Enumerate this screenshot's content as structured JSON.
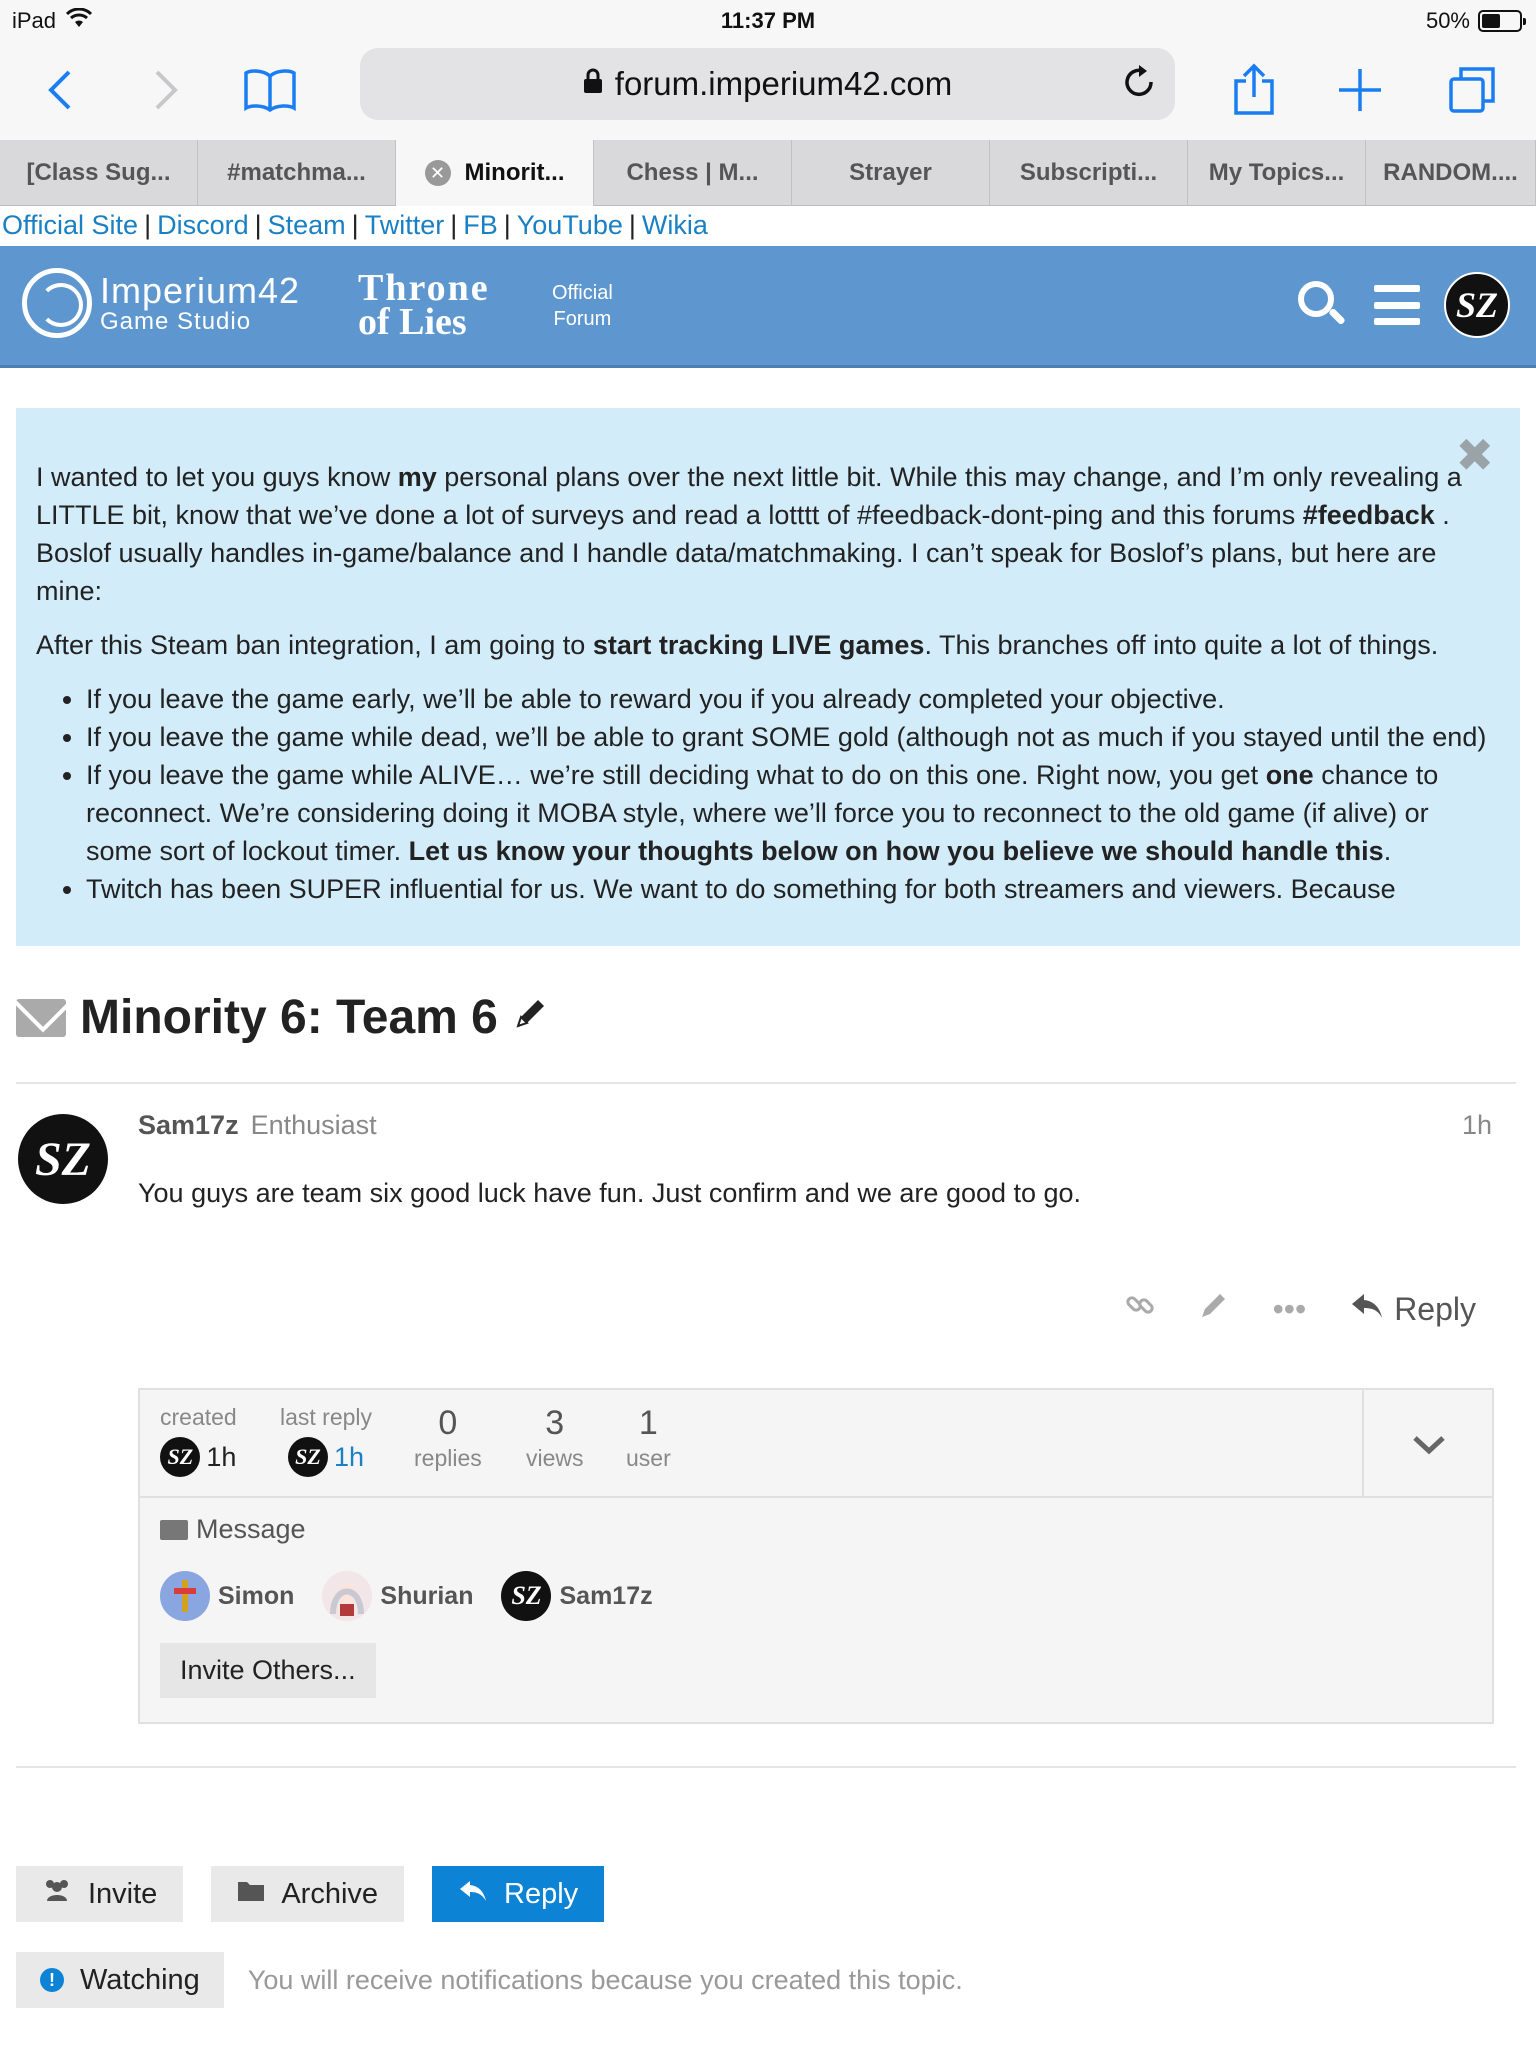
{
  "status": {
    "device": "iPad",
    "time": "11:37 PM",
    "battery": "50%"
  },
  "browser": {
    "url": "forum.imperium42.com",
    "tabs": [
      {
        "label": "[Class Sug..."
      },
      {
        "label": "#matchma..."
      },
      {
        "label": "Minorit..."
      },
      {
        "label": "Chess | M..."
      },
      {
        "label": "Strayer"
      },
      {
        "label": "Subscripti..."
      },
      {
        "label": "My Topics..."
      },
      {
        "label": "RANDOM...."
      }
    ]
  },
  "links": [
    "Official Site",
    "Discord",
    "Steam",
    "Twitter",
    "FB",
    "YouTube",
    "Wikia"
  ],
  "header": {
    "studio_line1": "Imperium42",
    "studio_line2": "Game Studio",
    "game_line1": "Throne",
    "game_line2": "of Lies",
    "official_line1": "Official",
    "official_line2": "Forum",
    "avatar_text": "SZ"
  },
  "announcement": {
    "p1_a": "I wanted to let you guys know ",
    "p1_b": "my",
    "p1_c": " personal plans over the next little bit. While this may change, and I’m only revealing a LITTLE bit, know that we’ve done a lot of surveys and read a lotttt of #feedback-dont-ping and this forums ",
    "p1_d": "#feedback",
    "p1_e": " . Boslof usually handles in-game/balance and I handle data/matchmaking. I can’t speak for Boslof’s plans, but here are mine:",
    "p2_a": "After this Steam ban integration, I am going to ",
    "p2_b": "start tracking LIVE games",
    "p2_c": ". This branches off into quite a lot of things.",
    "li1": "If you leave the game early, we’ll be able to reward you if you already completed your objective.",
    "li2": "If you leave the game while dead, we’ll be able to grant SOME gold (although not as much if you stayed until the end)",
    "li3_a": "If you leave the game while ALIVE… we’re still deciding what to do on this one. Right now, you get ",
    "li3_b": "one",
    "li3_c": " chance to reconnect. We’re considering doing it MOBA style, where we’ll force you to reconnect to the old game (if alive) or some sort of lockout timer. ",
    "li3_d": "Let us know your thoughts below on how you believe we should handle this",
    "li3_e": ".",
    "li4": "Twitch has been SUPER influential for us. We want to do something for both streamers and viewers. Because"
  },
  "topic": {
    "title": "Minority 6: Team 6"
  },
  "post": {
    "username": "Sam17z",
    "user_title": "Enthusiast",
    "age": "1h",
    "body": "You guys are team six good luck have fun. Just confirm and we are good to go.",
    "reply_label": "Reply"
  },
  "topic_map": {
    "created_label": "created",
    "created_value": "1h",
    "last_reply_label": "last reply",
    "last_reply_value": "1h",
    "replies_num": "0",
    "replies_label": "replies",
    "views_num": "3",
    "views_label": "views",
    "users_num": "1",
    "users_label": "user",
    "message_label": "Message",
    "participants": [
      {
        "name": "Simon"
      },
      {
        "name": "Shurian"
      },
      {
        "name": "Sam17z"
      }
    ],
    "invite_others": "Invite Others..."
  },
  "footer": {
    "invite": "Invite",
    "archive": "Archive",
    "reply": "Reply",
    "watching": "Watching",
    "notification_text": "You will receive notifications because you created this topic."
  },
  "colors": {
    "accent": "#0d83d6",
    "banner": "#5e97cf",
    "announce_bg": "#d2ecfa",
    "ios_blue": "#1a7ef2"
  }
}
